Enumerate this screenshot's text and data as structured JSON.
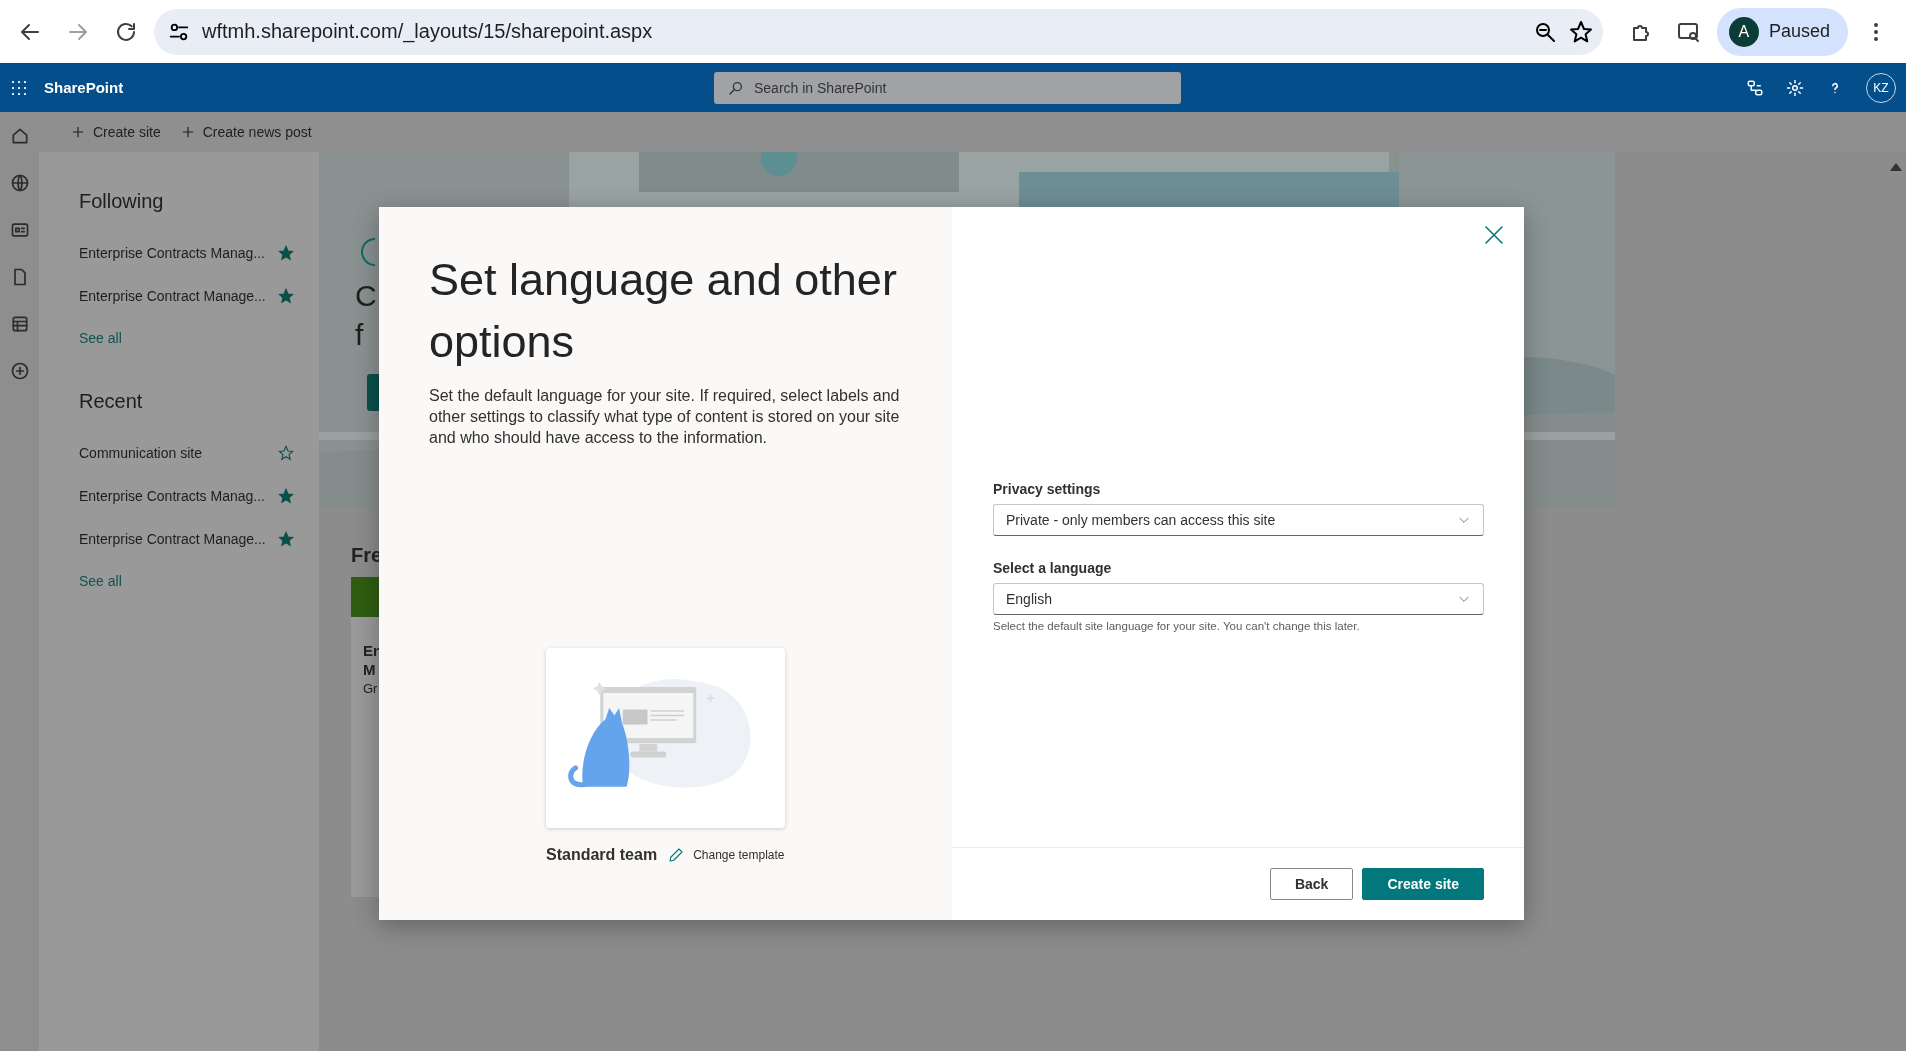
{
  "browser": {
    "url": "wftmh.sharepoint.com/_layouts/15/sharepoint.aspx",
    "profile": {
      "initial": "A",
      "status": "Paused"
    }
  },
  "suite_bar": {
    "app_name": "SharePoint",
    "search": {
      "placeholder": "Search in SharePoint"
    },
    "avatar": "KZ"
  },
  "command_bar": [
    "Create site",
    "Create news post"
  ],
  "nav": {
    "sections": [
      {
        "title": "Following",
        "items": [
          {
            "label": "Enterprise Contracts Manag...",
            "followed": true
          },
          {
            "label": "Enterprise Contract Manage...",
            "followed": true
          }
        ],
        "link": "See all"
      },
      {
        "title": "Recent",
        "items": [
          {
            "label": "Communication site",
            "followed": false
          },
          {
            "label": "Enterprise Contracts Manag...",
            "followed": true
          },
          {
            "label": "Enterprise Contract Manage...",
            "followed": true
          }
        ],
        "link": "See all"
      }
    ]
  },
  "background": {
    "hero_lines": [
      "C",
      "f"
    ],
    "frequent_heading": "Fre",
    "card_lines": [
      "En",
      "M",
      "Gr"
    ]
  },
  "dialog": {
    "title": "Set language and other options",
    "description": "Set the default language for your site. If required, select labels and other settings to classify what type of content is stored on your site and who should have access to the information.",
    "template": {
      "name": "Standard team",
      "change_link": "Change template"
    },
    "fields": [
      {
        "label": "Privacy settings",
        "value": "Private - only members can access this site"
      },
      {
        "label": "Select a language",
        "value": "English",
        "hint": "Select the default site language for your site. You can't change this later."
      }
    ],
    "buttons": [
      {
        "label": "Back",
        "primary": false
      },
      {
        "label": "Create site",
        "primary": true
      }
    ]
  }
}
